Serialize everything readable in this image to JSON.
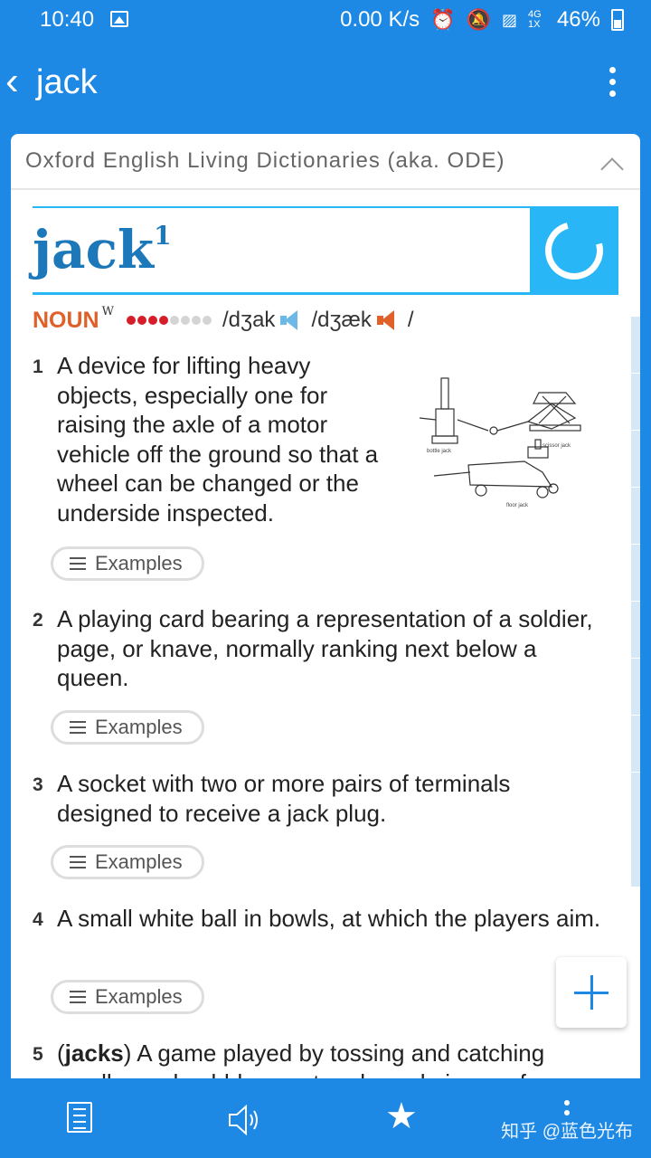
{
  "status_bar": {
    "time": "10:40",
    "network_speed": "0.00 K/s",
    "signal_label": "4G 1X",
    "battery": "46%"
  },
  "app_bar": {
    "title": "jack"
  },
  "dictionary": {
    "name": "Oxford English Living Dictionaries (aka. ODE)",
    "headword": "jack",
    "homograph": "1",
    "part_of_speech": "NOUN",
    "pos_marker": "W",
    "frequency": {
      "filled": 4,
      "total": 8
    },
    "pron_uk": "/dʒak",
    "pron_us": "/dʒæk",
    "pron_end": "/"
  },
  "senses": [
    {
      "num": "1",
      "definition": "A device for lifting heavy objects, especially one for raising the axle of a motor vehicle off the ground so that a wheel can be changed or the underside inspected.",
      "examples_label": "Examples"
    },
    {
      "num": "2",
      "definition": "A playing card bearing a representation of a soldier, page, or knave, normally ranking next below a queen.",
      "examples_label": "Examples"
    },
    {
      "num": "3",
      "definition": "A socket with two or more pairs of terminals designed to receive a jack plug.",
      "examples_label": "Examples"
    },
    {
      "num": "4",
      "definition": "A small white ball in bowls, at which the players aim.",
      "examples_label": "Examples"
    },
    {
      "num": "5",
      "bold_prefix": "jacks",
      "definition": " A game played by tossing and catching small round pebbles or star-shaped pieces of"
    }
  ],
  "illustration_labels": {
    "a": "bottle jack",
    "b": "scissor jack",
    "c": "floor jack"
  },
  "bottom_bar": {
    "watermark": "知乎 @蓝色光布"
  },
  "colors": {
    "primary": "#1e88e5",
    "headword": "#1c78b8",
    "accent_orange": "#e0602a",
    "frequency_red": "#d61e2b"
  }
}
